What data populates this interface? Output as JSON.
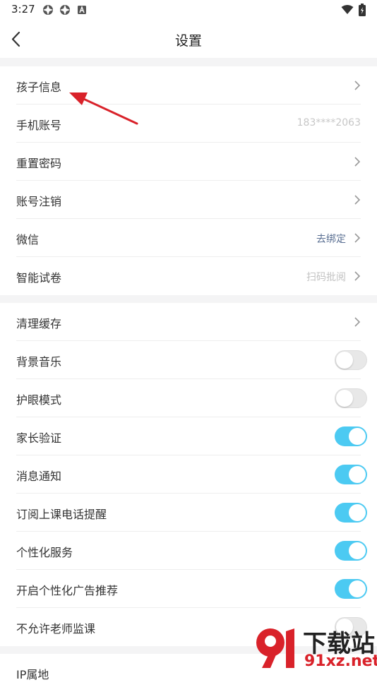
{
  "status_bar": {
    "time": "3:27",
    "icons": [
      "app-icon",
      "app-icon",
      "app-a-icon",
      "wifi-icon",
      "battery-icon"
    ]
  },
  "header": {
    "title": "设置",
    "back_icon": "back-arrow-icon"
  },
  "section1": [
    {
      "label": "孩子信息",
      "action": "chevron"
    },
    {
      "label": "手机账号",
      "value": "183****2063"
    },
    {
      "label": "重置密码",
      "action": "chevron"
    },
    {
      "label": "账号注销",
      "action": "chevron"
    },
    {
      "label": "微信",
      "value": "去绑定",
      "action": "chevron"
    },
    {
      "label": "智能试卷",
      "value": "扫码批阅",
      "action": "chevron"
    }
  ],
  "section2": [
    {
      "label": "清理缓存",
      "action": "chevron"
    },
    {
      "label": "背景音乐",
      "toggle": false
    },
    {
      "label": "护眼模式",
      "toggle": false
    },
    {
      "label": "家长验证",
      "toggle": true
    },
    {
      "label": "消息通知",
      "toggle": true
    },
    {
      "label": "订阅上课电话提醒",
      "toggle": true
    },
    {
      "label": "个性化服务",
      "toggle": true
    },
    {
      "label": "开启个性化广告推荐",
      "toggle": true
    },
    {
      "label": "不允许老师监课",
      "toggle": false
    }
  ],
  "section3": [
    {
      "label": "IP属地"
    }
  ],
  "colors": {
    "toggle_on": "#4ccaf2",
    "annotation_arrow": "#d9222a",
    "section_gap": "#f4f4f5"
  },
  "watermark": {
    "brand": "下载站",
    "url": "91xz.net"
  }
}
